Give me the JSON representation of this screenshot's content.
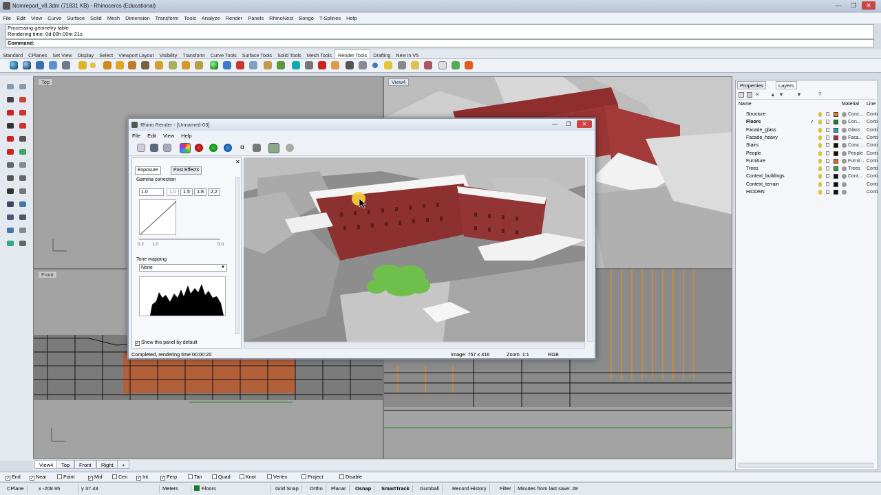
{
  "window": {
    "title": "Nomreport_v8.3dm (71831 KB) - Rhinoceros (Educational)",
    "min": "—",
    "max": "❐",
    "close": "✕"
  },
  "menu": [
    "File",
    "Edit",
    "View",
    "Curve",
    "Surface",
    "Solid",
    "Mesh",
    "Dimension",
    "Transform",
    "Tools",
    "Analyze",
    "Render",
    "Panels",
    "RhinoNest",
    "Bongo",
    "T-Splines",
    "Help"
  ],
  "history": [
    "Processing geometry table",
    "Rendering time: 0d 00h 00m 21s"
  ],
  "command": {
    "label": "Command:"
  },
  "toolbar_tabs": [
    "Standard",
    "CPlanes",
    "Set View",
    "Display",
    "Select",
    "Viewport Layout",
    "Visibility",
    "Transform",
    "Curve Tools",
    "Surface Tools",
    "Solid Tools",
    "Mesh Tools",
    "Render Tools",
    "Drafting",
    "New in V5"
  ],
  "active_tab": "Render Tools",
  "viewports": {
    "top": "Top",
    "perspective": "View4",
    "front": "Front",
    "bottom_tabs": [
      "View4",
      "Top",
      "Front",
      "Right",
      "+"
    ]
  },
  "render_window": {
    "title": "Rhino Render - [Unnamed-03]",
    "menu": [
      "File",
      "Edit",
      "View",
      "Help"
    ],
    "tabs": [
      "Exposure",
      "Post Effects"
    ],
    "gamma": {
      "label": "Gamma correction",
      "value": "1.0",
      "presets": [
        "1.0",
        "1.5",
        "1.8",
        "2.2"
      ],
      "scale_left": "0.2",
      "scale_mid": "1.0",
      "scale_right": "5.0"
    },
    "tone": {
      "label": "Tone mapping",
      "value": "None"
    },
    "show_default": "Show this panel by default",
    "status": "Completed, rendering time 00:00:20",
    "image_size": "Image: 757 x 416",
    "zoom": "Zoom: 1:1",
    "channel": "RGB"
  },
  "panel": {
    "tabs": [
      "Properties",
      "Layers"
    ],
    "columns": [
      "Name",
      "Material",
      "Line"
    ],
    "layers": [
      {
        "name": "Structure",
        "color": "#e07b1a",
        "material": "Conc...",
        "line": "Conti"
      },
      {
        "name": "Floors",
        "color": "#1e7b2e",
        "material": "Con...",
        "line": "Conti",
        "current": "✓"
      },
      {
        "name": "Facade_glass",
        "color": "#1aa5a5",
        "material": "Glass",
        "line": "Conti"
      },
      {
        "name": "Facade_heavy",
        "color": "#a83232",
        "material": "Faca...",
        "line": "Conti"
      },
      {
        "name": "Stairs",
        "color": "#111111",
        "material": "Conc...",
        "line": "Conti"
      },
      {
        "name": "People",
        "color": "#111111",
        "material": "People",
        "line": "Conti"
      },
      {
        "name": "Furniture",
        "color": "#e06a10",
        "material": "Furnit...",
        "line": "Conti"
      },
      {
        "name": "Trees",
        "color": "#2e9e2e",
        "material": "Trees",
        "line": "Conti"
      },
      {
        "name": "Context_buildings",
        "color": "#111111",
        "material": "Cont...",
        "line": "Conti"
      },
      {
        "name": "Context_terrain",
        "color": "#111111",
        "material": "",
        "line": "Conti"
      },
      {
        "name": "HIDDEN",
        "color": "#111111",
        "material": "",
        "line": "Conti"
      }
    ]
  },
  "osnaps": [
    {
      "label": "End",
      "on": true
    },
    {
      "label": "Near",
      "on": true
    },
    {
      "label": "Point",
      "on": false
    },
    {
      "label": "Mid",
      "on": true
    },
    {
      "label": "Cen",
      "on": false
    },
    {
      "label": "Int",
      "on": true
    },
    {
      "label": "Perp",
      "on": true
    },
    {
      "label": "Tan",
      "on": false
    },
    {
      "label": "Quad",
      "on": false
    },
    {
      "label": "Knot",
      "on": false
    },
    {
      "label": "Vertex",
      "on": false
    },
    {
      "label": "Project",
      "on": false
    },
    {
      "label": "Disable",
      "on": false
    }
  ],
  "status": {
    "cplane": "CPlane",
    "x": "x -208.95",
    "y": "y 37.43",
    "units": "Meters",
    "layer": "Floors",
    "grid_snap": "Grid Snap",
    "ortho": "Ortho",
    "planar": "Planar",
    "osnap": "Osnap",
    "smarttrack": "SmartTrack",
    "gumball": "Gumball",
    "record_history": "Record History",
    "filter": "Filter",
    "save_info": "Minutes from last save: 28"
  }
}
